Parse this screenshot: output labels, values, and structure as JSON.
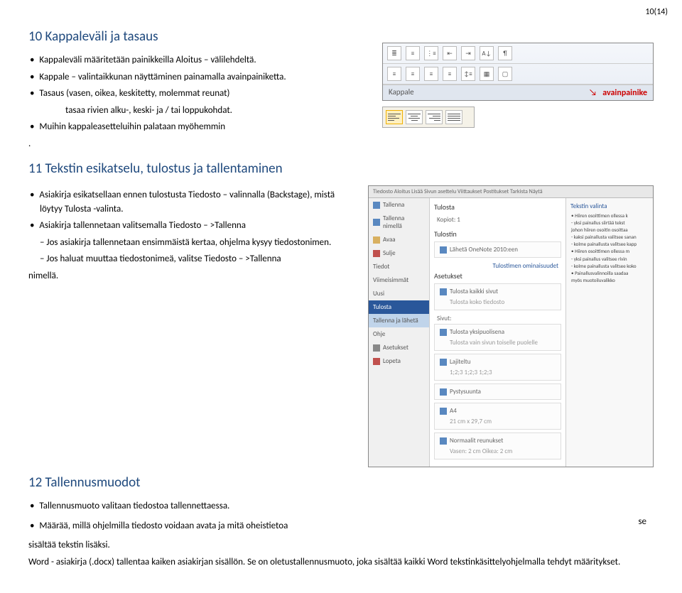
{
  "page_number": "10(14)",
  "sec10": {
    "title": "10 Kappaleväli ja tasaus",
    "b1": "Kappaleväli määritetään painikkeilla Aloitus – välilehdeltä.",
    "b2": "Kappale – valintaikkunan näyttäminen painamalla avainpainiketta.",
    "b3": "Tasaus (vasen, oikea, keskitetty, molemmat reunat)",
    "b3sub": "tasaa rivien alku-, keski- ja / tai loppukohdat.",
    "b4": "Muihin kappaleasetteluihin palataan myöhemmin",
    "period": "."
  },
  "ribbon": {
    "group_label": "Kappale",
    "callout": "avainpainike"
  },
  "sec11": {
    "title": "11 Tekstin esikatselu, tulostus ja tallentaminen",
    "b1": "Asiakirja esikatsellaan ennen tulostusta Tiedosto – valinnalla (Backstage), mistä löytyy Tulosta -valinta.",
    "b2": "Asiakirja tallennetaan valitsemalla Tiedosto – >Tallenna",
    "d1": "Jos asiakirja tallennetaan ensimmäistä kertaa, ohjelma kysyy tiedostonimen.",
    "d2": "Jos haluat muuttaa tiedostonimeä, valitse Tiedosto – >Tallenna",
    "nimella": "nimellä."
  },
  "backstage": {
    "tabs": "Tiedosto   Aloitus   Lisää   Sivun asettelu   Viittaukset   Postitukset   Tarkista   Näytä",
    "left": [
      "Tallenna",
      "Tallenna nimellä",
      "Avaa",
      "Sulje",
      "Tiedot",
      "Viimeisimmät",
      "Uusi",
      "Tulosta",
      "Tallenna ja lähetä",
      "Ohje",
      "Asetukset",
      "Lopeta"
    ],
    "mid": {
      "h1": "Tulosta",
      "kopiot": "Kopiot: 1",
      "h2": "Tulostin",
      "printer": "Lähetä OneNote 2010:een",
      "props": "Tulostimen ominaisuudet",
      "h3": "Asetukset",
      "s1": "Tulosta kaikki sivut",
      "s1b": "Tulosta koko tiedosto",
      "sivut": "Sivut:",
      "s2": "Tulosta yksipuolisena",
      "s2b": "Tulosta vain sivun toiselle puolelle",
      "s3": "Lajiteltu",
      "s3b": "1;2;3    1;2;3    1;2;3",
      "s4": "Pystysuunta",
      "s5": "A4",
      "s5b": "21 cm x 29,7 cm",
      "s6": "Normaalit reunukset",
      "s6b": "Vasen: 2 cm   Oikea: 2 cm"
    },
    "doc": {
      "title": "Tekstin valinta",
      "bullets": [
        "Hiiren osoittimen ollessa k",
        "yksi painallus siirtää tekst",
        "johon hiiren osoitin osoittaa",
        "kaksi painallusta valitsee sanan",
        "kolme painallusta valitsee kapp",
        "Hiiren osoittimen ollessa m",
        "yksi painallus valitsee rivin",
        "kolme painallusta valitsee koko",
        "Painallusvalinnoilla saadaa",
        "myös muotoiluvalikko"
      ]
    }
  },
  "sec12": {
    "title": "12 Tallennusmuodot",
    "b1": "Tallennusmuoto valitaan tiedostoa tallennettaessa.",
    "b2a": "Määrää, millä ohjelmilla tiedosto voidaan avata ja mitä oheistietoa",
    "b2b": "se",
    "b2c": "sisältää tekstin lisäksi.",
    "p3": "Word - asiakirja (.docx) tallentaa kaiken asiakirjan sisällön. Se on oletustallennusmuoto, joka sisältää kaikki Word tekstinkäsittelyohjelmalla tehdyt määritykset."
  }
}
